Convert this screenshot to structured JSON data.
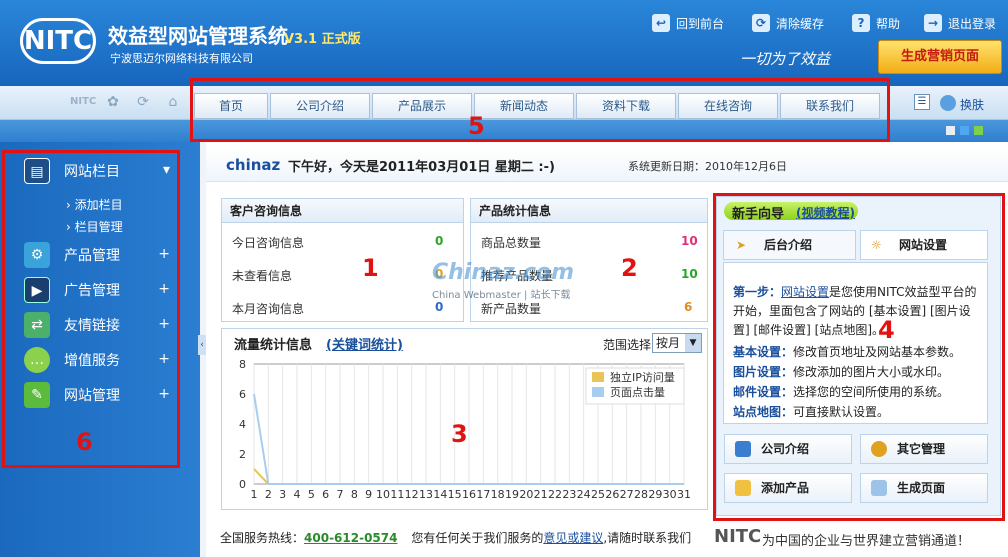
{
  "header": {
    "logo_text": "NITC",
    "title": "效益型网站管理系统",
    "version": "V3.1 正式版",
    "company": "宁波思迈尔网络科技有限公司",
    "slogan": "一切为了效益",
    "generate_button": "生成营销页面",
    "links": [
      {
        "label": "回到前台",
        "icon": "back-icon"
      },
      {
        "label": "清除缓存",
        "icon": "clear-cache-icon"
      },
      {
        "label": "帮助",
        "icon": "help-icon"
      },
      {
        "label": "退出登录",
        "icon": "logout-icon"
      }
    ]
  },
  "nav": {
    "tabs": [
      "首页",
      "公司介绍",
      "产品展示",
      "新闻动态",
      "资料下载",
      "在线咨询",
      "联系我们"
    ],
    "skin_label": "换肤"
  },
  "sidebar": {
    "items": [
      {
        "label": "网站栏目",
        "icon": "columns-icon",
        "toggle": "▾"
      },
      {
        "label": "产品管理",
        "icon": "gear-icon",
        "toggle": "+"
      },
      {
        "label": "广告管理",
        "icon": "ad-icon",
        "toggle": "+"
      },
      {
        "label": "友情链接",
        "icon": "link-icon",
        "toggle": "+"
      },
      {
        "label": "增值服务",
        "icon": "chat-icon",
        "toggle": "+"
      },
      {
        "label": "网站管理",
        "icon": "pen-icon",
        "toggle": "+"
      }
    ],
    "sub_items": [
      "添加栏目",
      "栏目管理"
    ]
  },
  "welcome": {
    "user": "chinaz",
    "greeting": "下午好，今天是2011年03月01日 星期二 :-)",
    "update_date": "系统更新日期：2010年12月6日"
  },
  "customer_panel": {
    "title": "客户咨询信息",
    "rows": [
      {
        "label": "今日咨询信息",
        "value": "0"
      },
      {
        "label": "未查看信息",
        "value": "0"
      },
      {
        "label": "本月咨询信息",
        "value": "0"
      }
    ]
  },
  "product_panel": {
    "title": "产品统计信息",
    "rows": [
      {
        "label": "商品总数量",
        "value": "10"
      },
      {
        "label": "推荐产品数量",
        "value": "10"
      },
      {
        "label": "新产品数量",
        "value": "6"
      }
    ]
  },
  "watermark": {
    "main": "Chinaz.com",
    "sub": "China Webmaster | 站长下载"
  },
  "traffic": {
    "title": "流量统计信息",
    "keyword_link": "(关键词统计)",
    "range_label": "范围选择",
    "range_value": "按月"
  },
  "chart_data": {
    "type": "line",
    "x": [
      1,
      2,
      3,
      4,
      5,
      6,
      7,
      8,
      9,
      10,
      11,
      12,
      13,
      14,
      15,
      16,
      17,
      18,
      19,
      20,
      21,
      22,
      23,
      24,
      25,
      26,
      27,
      28,
      29,
      30,
      31
    ],
    "ylim": [
      0,
      8
    ],
    "yticks": [
      0,
      2,
      4,
      6,
      8
    ],
    "series": [
      {
        "name": "独立IP访问量",
        "color": "#e8c45a",
        "values": [
          1,
          0,
          0,
          0,
          0,
          0,
          0,
          0,
          0,
          0,
          0,
          0,
          0,
          0,
          0,
          0,
          0,
          0,
          0,
          0,
          0,
          0,
          0,
          0,
          0,
          0,
          0,
          0,
          0,
          0,
          0
        ]
      },
      {
        "name": "页面点击量",
        "color": "#a9cdee",
        "values": [
          6,
          0,
          0,
          0,
          0,
          0,
          0,
          0,
          0,
          0,
          0,
          0,
          0,
          0,
          0,
          0,
          0,
          0,
          0,
          0,
          0,
          0,
          0,
          0,
          0,
          0,
          0,
          0,
          0,
          0,
          0
        ]
      }
    ],
    "grid": true,
    "legend": "top-right"
  },
  "guide": {
    "title": "新手向导",
    "video_link": "(视频教程)",
    "tabs": [
      "后台介绍",
      "网站设置"
    ],
    "step_label": "第一步：",
    "step_link": "网站设置",
    "step_text": "是您使用NITC效益型平台的开始，里面包含了网站的 [基本设置] [图片设置] [邮件设置] [站点地图]。",
    "items": [
      {
        "key": "基本设置：",
        "text": "修改首页地址及网站基本参数。"
      },
      {
        "key": "图片设置：",
        "text": "修改添加的图片大小或水印。"
      },
      {
        "key": "邮件设置：",
        "text": "选择您的空间所使用的系统。"
      },
      {
        "key": "站点地图：",
        "text": "可直接默认设置。"
      }
    ],
    "buttons": [
      "公司介绍",
      "其它管理",
      "添加产品",
      "生成页面"
    ]
  },
  "footer": {
    "hotline_label": "全国服务热线：",
    "hotline": "400-612-0574",
    "text_pre": "您有任何关于我们服务的",
    "text_link": "意见或建议",
    "text_post": ",请随时联系我们",
    "brand": "NITC",
    "brand_slogan": "为中国的企业与世界建立营销通道！"
  },
  "annotations": [
    "1",
    "2",
    "3",
    "4",
    "5",
    "6"
  ],
  "colors": {
    "accent": "#1766bd",
    "annotation": "#e01212",
    "link": "#1a4f9c"
  }
}
